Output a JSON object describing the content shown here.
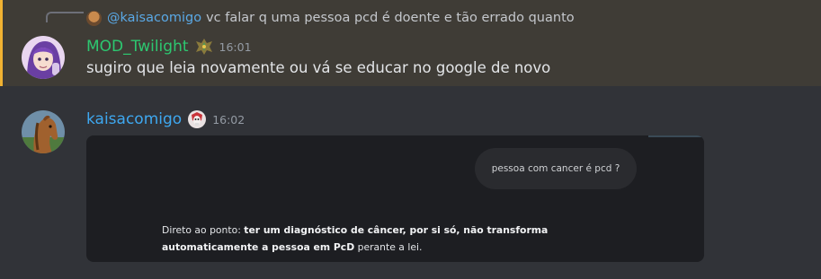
{
  "reply": {
    "username": "@kaisacomigo",
    "text": "vc falar q uma pessoa pcd é doente e tão errado quanto"
  },
  "messages": [
    {
      "username": "MOD_Twilight",
      "username_color": "#2dc770",
      "timestamp": "16:01",
      "text": "sugiro que leia novamente ou vá se educar no google de novo",
      "highlight_color": "#f0b232"
    },
    {
      "username": "kaisacomigo",
      "username_color": "#3ea8f0",
      "timestamp": "16:02",
      "attachment": {
        "question": "pessoa com cancer é pcd ?",
        "answer_prefix": "Direto ao ponto: ",
        "answer_bold_1": "ter um diagnóstico de câncer, por si só, não transforma automaticamente a pessoa em PcD",
        "answer_suffix": " perante a lei."
      }
    }
  ],
  "icons": {
    "reply_avatar": "horse-avatar-icon",
    "badge_1": "guild-crest-icon",
    "badge_2": "skull-badge-icon"
  }
}
